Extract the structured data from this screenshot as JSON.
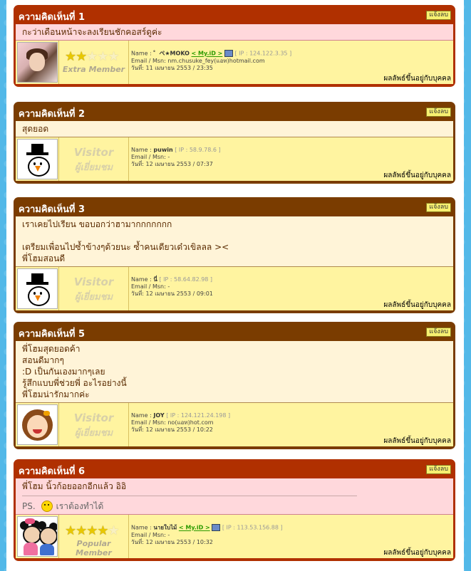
{
  "report_label": "แจ้งลบ",
  "disclaimer": "ผลลัพธ์ขึ้นอยู่กับบุคคล",
  "labels": {
    "name": "Name : ",
    "email": "Email / Msn: ",
    "date": "วันที่: "
  },
  "comments": [
    {
      "title": "ความคิดเห็นที่ 1",
      "lines": [
        "กะว่าเดือนหน้าจะลงเรียนชักคอสร์ดูค่ะ"
      ],
      "name": "゜ペ★MOKO",
      "myid": "< My.iD >",
      "ip": "[ IP : 124.122.3.35 ]",
      "email": "nm.chusuke_fey(แอท)hotmail.com",
      "date": "11 เมษายน 2553 / 23:35",
      "rank_label": "Extra Member",
      "rank_stars": 2
    },
    {
      "title": "ความคิดเห็นที่ 2",
      "lines": [
        "สุดยอด"
      ],
      "name": "puwin",
      "ip": "[ IP : 58.9.78.6 ]",
      "email": "-",
      "date": "12 เมษายน 2553 / 07:37",
      "visitor_en": "Visitor",
      "visitor_th": "ผู้เยี่ยมชม"
    },
    {
      "title": "ความคิดเห็นที่ 3",
      "lines": [
        "เราเคยไปเรียน ขอบอกว่าฮามากกกกกกก",
        "",
        "เตรียมเพื่อนไปซ้ำข้างๆด้วยนะ ซ้ำคนเดียวเด๋วเขิลลล ><",
        "พี่โฮมสอนดี"
      ],
      "name": "นี่",
      "ip": "[ IP : 58.64.82.98 ]",
      "email": "-",
      "date": "12 เมษายน 2553 / 09:01",
      "visitor_en": "Visitor",
      "visitor_th": "ผู้เยี่ยมชม"
    },
    {
      "title": "ความคิดเห็นที่ 5",
      "lines": [
        "พี่โฮมสุดยอดค้า",
        "สอนดีมากๆ",
        ":D เป็นกันเองมากๆเลย",
        "รู้สึกแบบพี่ช่วยพี่ อะไรอย่างนี้",
        "พี่โฮมน่ารักมากค่ะ"
      ],
      "name": "JOY",
      "ip": "[ IP : 124.121.24.198 ]",
      "email": "no(แอท)hot.com",
      "date": "12 เมษายน 2553 / 10:22",
      "visitor_en": "Visitor",
      "visitor_th": "ผู้เยี่ยมชม"
    },
    {
      "title": "ความคิดเห็นที่ 6",
      "lines": [
        "พี่โฮม นิ้วก้อยออกอีกแล้ว อิอิ"
      ],
      "ps_prefix": "PS.",
      "ps_text": "เราต้องทำได้",
      "name": "นายใบไม้",
      "myid": "< My.iD >",
      "ip": "[ IP : 113.53.156.88 ]",
      "email": "-",
      "date": "12 เมษายน 2553 / 10:32",
      "rank_label": "Popular Member",
      "rank_stars": 4
    }
  ]
}
